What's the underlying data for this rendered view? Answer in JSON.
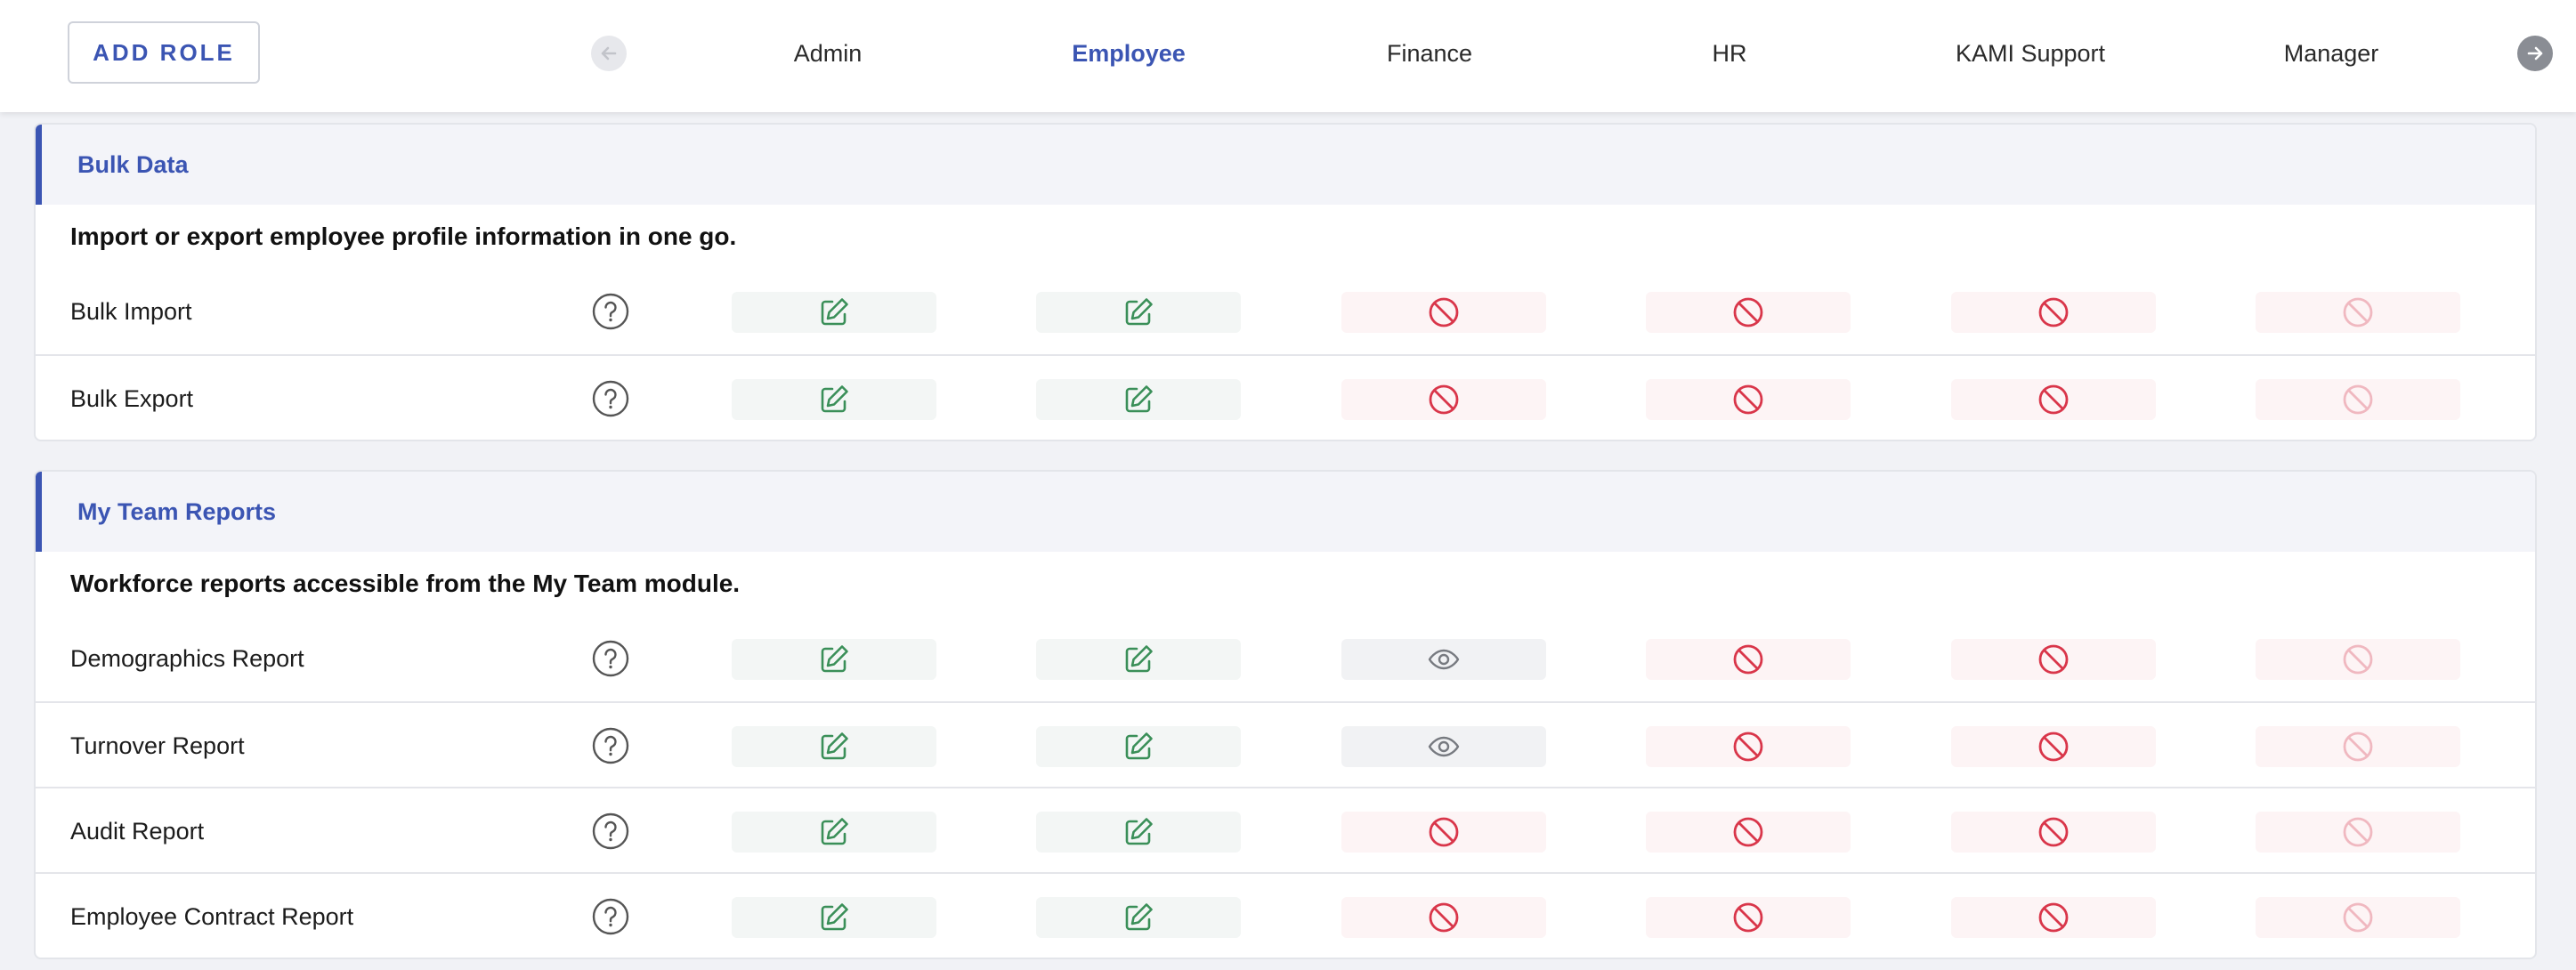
{
  "header": {
    "add_role_label": "ADD ROLE",
    "roles": [
      "Admin",
      "Employee",
      "Finance",
      "HR",
      "KAMI Support",
      "Manager"
    ],
    "active_role": "Employee"
  },
  "colors": {
    "accent": "#3b55b3",
    "edit": "#3a8f58",
    "deny": "#d9364a",
    "deny_faded": "#f0b8c0",
    "view": "#777a80"
  },
  "icons": {
    "edit": "edit-icon",
    "view": "eye-icon",
    "deny": "no-access-icon",
    "help": "help-icon"
  },
  "sections": [
    {
      "title": "Bulk Data",
      "description": "Import or export employee profile information in one go.",
      "rows": [
        {
          "label": "Bulk Import",
          "perms": [
            "edit",
            "edit",
            "deny",
            "deny",
            "deny",
            "deny-faded"
          ]
        },
        {
          "label": "Bulk Export",
          "perms": [
            "edit",
            "edit",
            "deny",
            "deny",
            "deny",
            "deny-faded"
          ]
        }
      ]
    },
    {
      "title": "My Team Reports",
      "description": "Workforce reports accessible from the My Team module.",
      "rows": [
        {
          "label": "Demographics Report",
          "perms": [
            "edit",
            "edit",
            "view",
            "deny",
            "deny",
            "deny-faded"
          ]
        },
        {
          "label": "Turnover Report",
          "perms": [
            "edit",
            "edit",
            "view",
            "deny",
            "deny",
            "deny-faded"
          ]
        },
        {
          "label": "Audit Report",
          "perms": [
            "edit",
            "edit",
            "deny",
            "deny",
            "deny",
            "deny-faded"
          ]
        },
        {
          "label": "Employee Contract Report",
          "perms": [
            "edit",
            "edit",
            "deny",
            "deny",
            "deny",
            "deny-faded"
          ]
        }
      ]
    }
  ]
}
